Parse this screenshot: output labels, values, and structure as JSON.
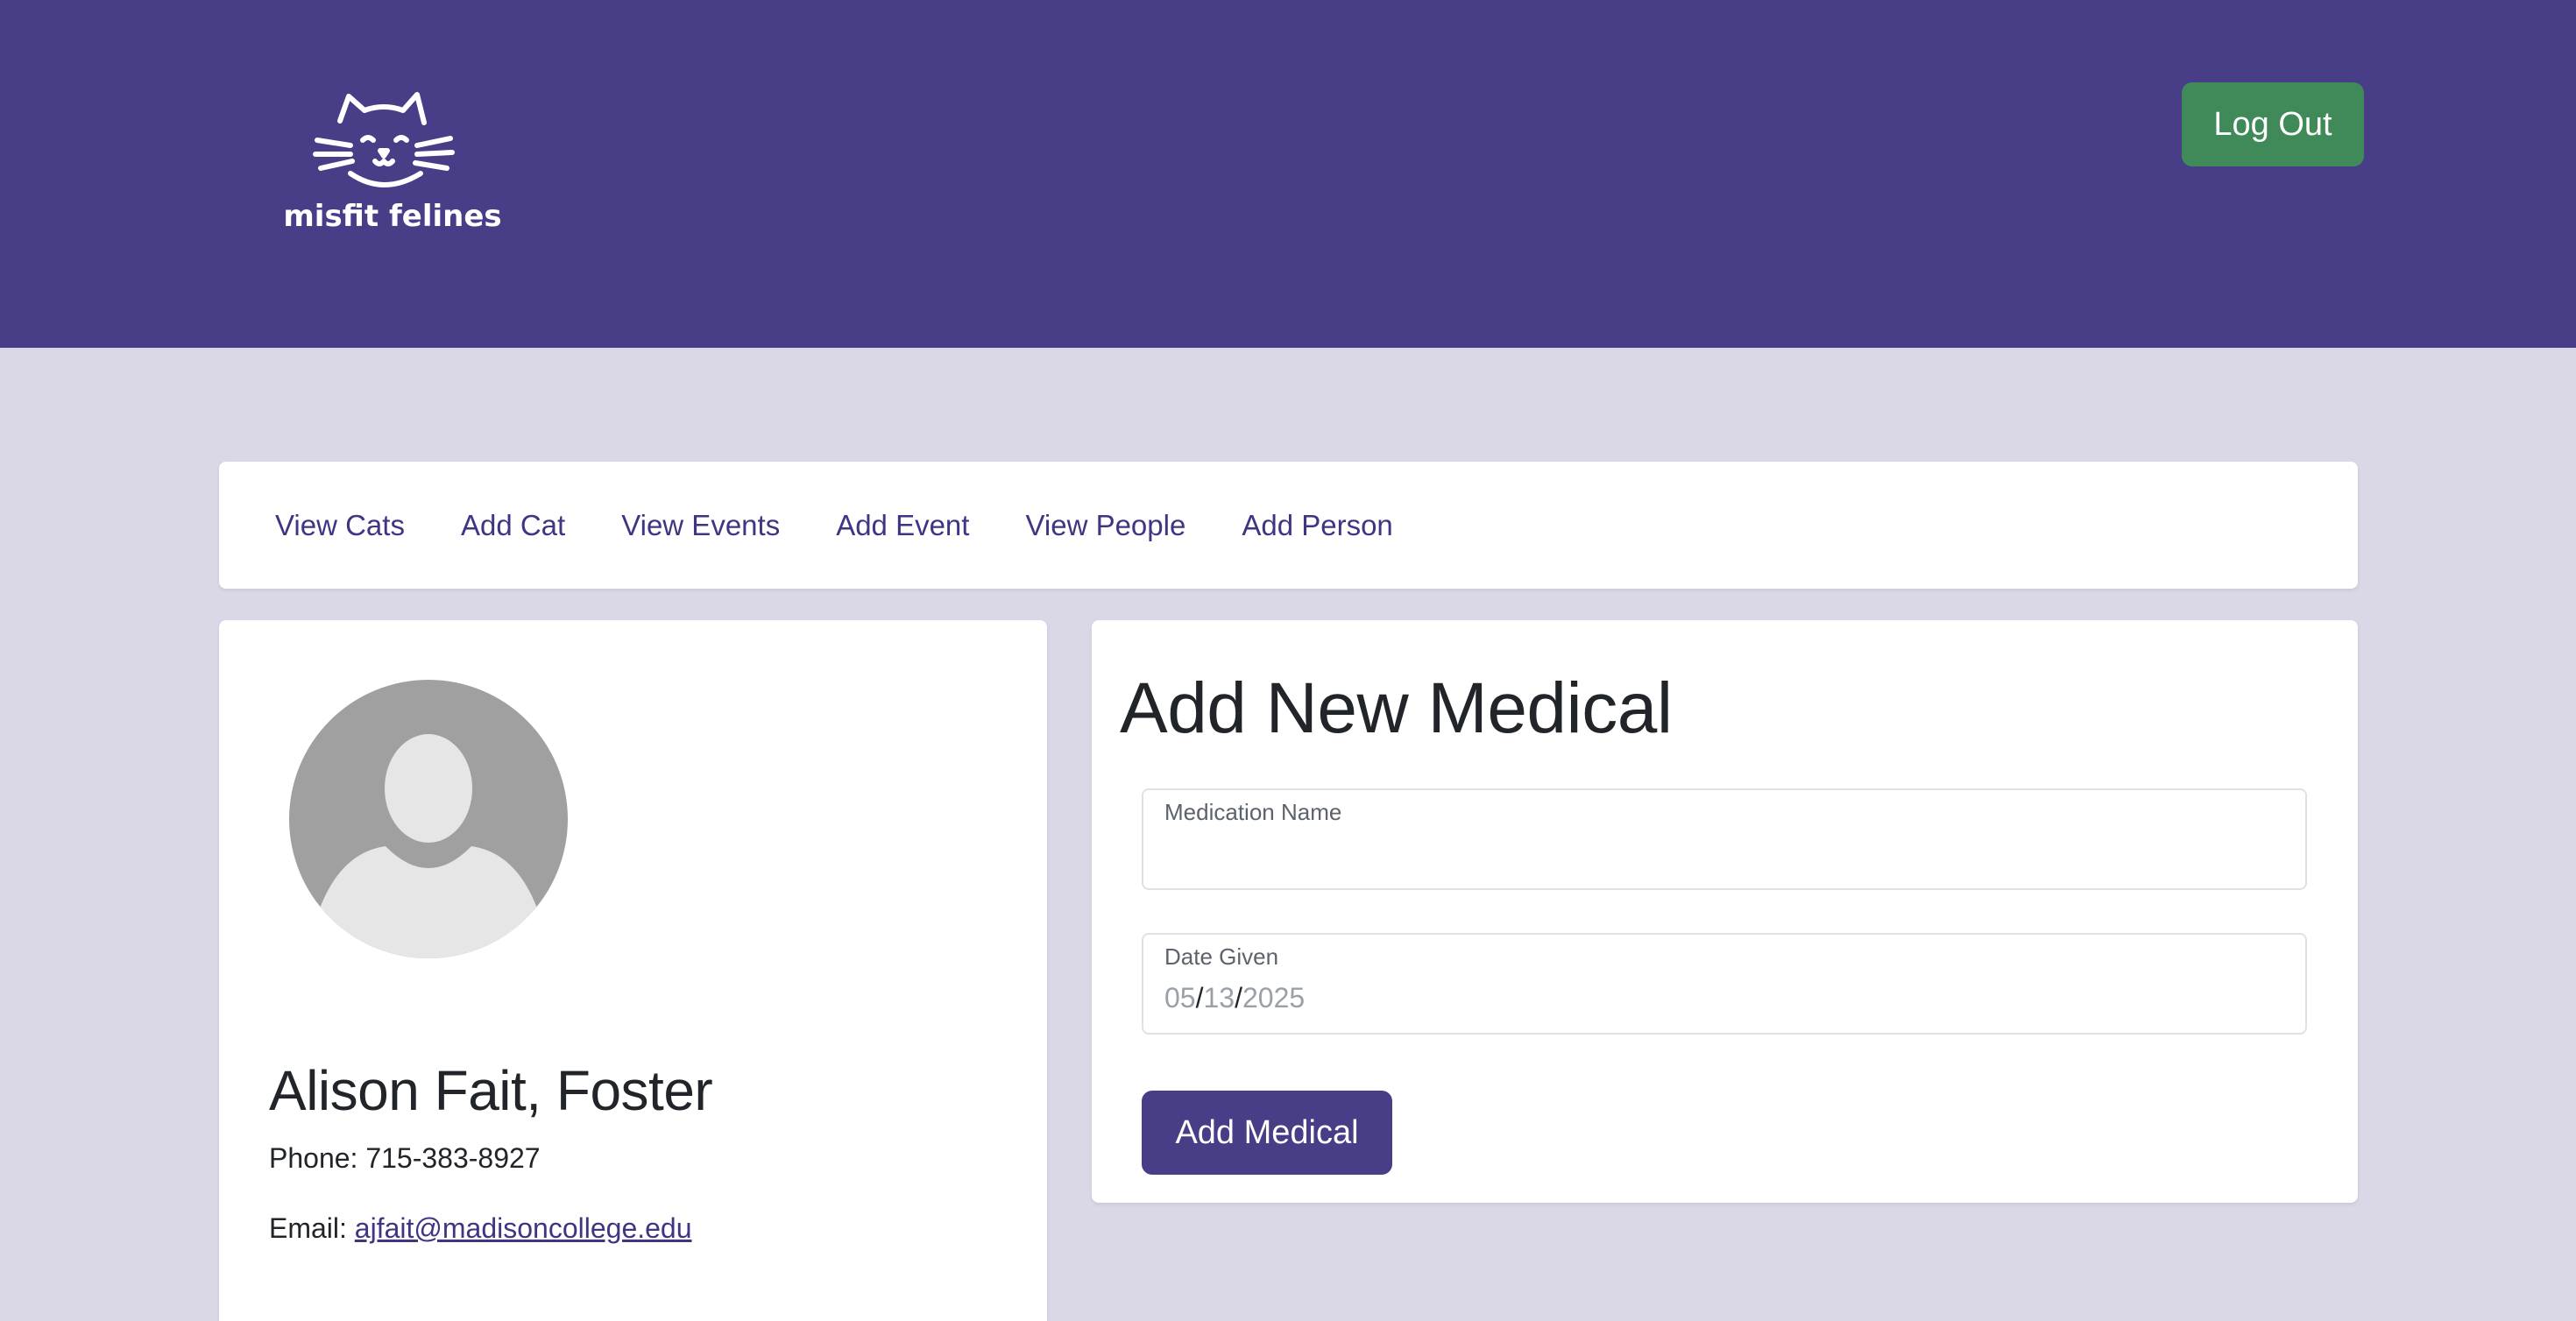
{
  "brand": {
    "logo_text": "misfit felines"
  },
  "header": {
    "logout_label": "Log Out"
  },
  "nav": {
    "items": [
      {
        "label": "View Cats"
      },
      {
        "label": "Add Cat"
      },
      {
        "label": "View Events"
      },
      {
        "label": "Add Event"
      },
      {
        "label": "View People"
      },
      {
        "label": "Add Person"
      }
    ]
  },
  "person": {
    "name": "Alison Fait, Foster",
    "phone_label": "Phone:",
    "phone": "715-383-8927",
    "email_label": "Email:",
    "email": "ajfait@madisoncollege.edu",
    "avatar_icon": "user-placeholder-icon"
  },
  "form": {
    "title": "Add New Medical",
    "medication_label": "Medication Name",
    "medication_value": "",
    "date_label": "Date Given",
    "date_month": "05",
    "date_day": "13",
    "date_year": "2025",
    "date_sep": "/",
    "submit_label": "Add Medical"
  },
  "colors": {
    "header_bg": "#483d87",
    "page_bg": "#dad8e7",
    "logout_bg": "#3f8a58",
    "primary_button": "#483d87",
    "link": "#3f3683"
  }
}
